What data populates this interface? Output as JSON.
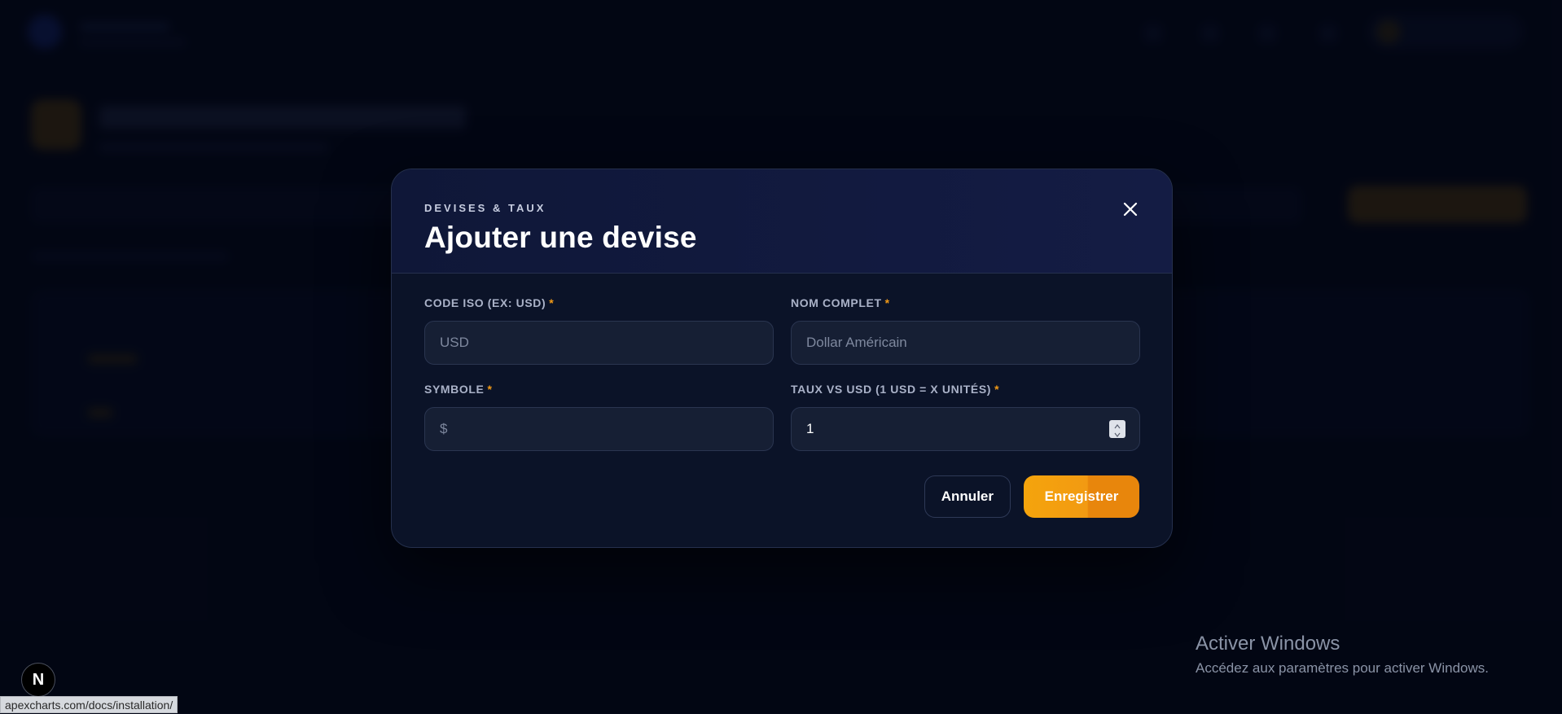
{
  "modal": {
    "eyebrow": "DEVISES & TAUX",
    "title": "Ajouter une devise",
    "fields": {
      "code": {
        "label": "CODE ISO (EX: USD)",
        "required_mark": "*",
        "placeholder": "USD",
        "value": ""
      },
      "name": {
        "label": "NOM COMPLET",
        "required_mark": "*",
        "placeholder": "Dollar Américain",
        "value": ""
      },
      "symbol": {
        "label": "SYMBOLE",
        "required_mark": "*",
        "placeholder": "$",
        "value": ""
      },
      "rate": {
        "label": "TAUX VS USD (1 USD = X UNITÉS)",
        "required_mark": "*",
        "value": "1"
      }
    },
    "cancel_label": "Annuler",
    "save_label": "Enregistrer"
  },
  "watermark": {
    "title": "Activer Windows",
    "subtitle": "Accédez aux paramètres pour activer Windows."
  },
  "next_badge": "N",
  "status_url": "apexcharts.com/docs/installation/",
  "colors": {
    "background": "#040818",
    "modal_bg": "#0b1328",
    "accent": "#f29a17",
    "input_bg": "#161f34"
  }
}
